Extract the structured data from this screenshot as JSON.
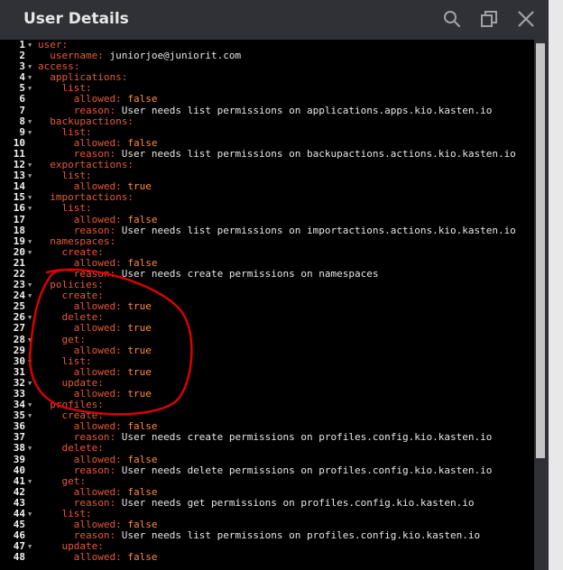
{
  "dialog": {
    "title": "User Details"
  },
  "header_icons": [
    {
      "name": "search-icon"
    },
    {
      "name": "maximize-icon"
    },
    {
      "name": "close-icon"
    }
  ],
  "colors": {
    "key": "#e8583c",
    "value": "#e8e8e8",
    "boolean": "#ff8a3d",
    "annotation": "#e00000"
  },
  "lines": [
    {
      "n": "1",
      "fold": true,
      "indent": 0,
      "key": "user",
      "value": "",
      "vtype": ""
    },
    {
      "n": "2",
      "fold": false,
      "indent": 1,
      "key": "username",
      "value": "juniorjoe@juniorit.com",
      "vtype": "str"
    },
    {
      "n": "3",
      "fold": true,
      "indent": 0,
      "key": "access",
      "value": "",
      "vtype": ""
    },
    {
      "n": "4",
      "fold": true,
      "indent": 1,
      "key": "applications",
      "value": "",
      "vtype": ""
    },
    {
      "n": "5",
      "fold": true,
      "indent": 2,
      "key": "list",
      "value": "",
      "vtype": ""
    },
    {
      "n": "6",
      "fold": false,
      "indent": 3,
      "key": "allowed",
      "value": "false",
      "vtype": "bool"
    },
    {
      "n": "7",
      "fold": false,
      "indent": 3,
      "key": "reason",
      "value": "User needs list permissions on applications.apps.kio.kasten.io",
      "vtype": "str"
    },
    {
      "n": "8",
      "fold": true,
      "indent": 1,
      "key": "backupactions",
      "value": "",
      "vtype": ""
    },
    {
      "n": "9",
      "fold": true,
      "indent": 2,
      "key": "list",
      "value": "",
      "vtype": ""
    },
    {
      "n": "10",
      "fold": false,
      "indent": 3,
      "key": "allowed",
      "value": "false",
      "vtype": "bool"
    },
    {
      "n": "11",
      "fold": false,
      "indent": 3,
      "key": "reason",
      "value": "User needs list permissions on backupactions.actions.kio.kasten.io",
      "vtype": "str"
    },
    {
      "n": "12",
      "fold": true,
      "indent": 1,
      "key": "exportactions",
      "value": "",
      "vtype": ""
    },
    {
      "n": "13",
      "fold": true,
      "indent": 2,
      "key": "list",
      "value": "",
      "vtype": ""
    },
    {
      "n": "14",
      "fold": false,
      "indent": 3,
      "key": "allowed",
      "value": "true",
      "vtype": "bool"
    },
    {
      "n": "15",
      "fold": true,
      "indent": 1,
      "key": "importactions",
      "value": "",
      "vtype": ""
    },
    {
      "n": "16",
      "fold": true,
      "indent": 2,
      "key": "list",
      "value": "",
      "vtype": ""
    },
    {
      "n": "17",
      "fold": false,
      "indent": 3,
      "key": "allowed",
      "value": "false",
      "vtype": "bool"
    },
    {
      "n": "18",
      "fold": false,
      "indent": 3,
      "key": "reason",
      "value": "User needs list permissions on importactions.actions.kio.kasten.io",
      "vtype": "str"
    },
    {
      "n": "19",
      "fold": true,
      "indent": 1,
      "key": "namespaces",
      "value": "",
      "vtype": ""
    },
    {
      "n": "20",
      "fold": true,
      "indent": 2,
      "key": "create",
      "value": "",
      "vtype": ""
    },
    {
      "n": "21",
      "fold": false,
      "indent": 3,
      "key": "allowed",
      "value": "false",
      "vtype": "bool"
    },
    {
      "n": "22",
      "fold": false,
      "indent": 3,
      "key": "reason",
      "value": "User needs create permissions on namespaces",
      "vtype": "str"
    },
    {
      "n": "23",
      "fold": true,
      "indent": 1,
      "key": "policies",
      "value": "",
      "vtype": ""
    },
    {
      "n": "24",
      "fold": true,
      "indent": 2,
      "key": "create",
      "value": "",
      "vtype": ""
    },
    {
      "n": "25",
      "fold": false,
      "indent": 3,
      "key": "allowed",
      "value": "true",
      "vtype": "bool"
    },
    {
      "n": "26",
      "fold": true,
      "indent": 2,
      "key": "delete",
      "value": "",
      "vtype": ""
    },
    {
      "n": "27",
      "fold": false,
      "indent": 3,
      "key": "allowed",
      "value": "true",
      "vtype": "bool"
    },
    {
      "n": "28",
      "fold": true,
      "indent": 2,
      "key": "get",
      "value": "",
      "vtype": ""
    },
    {
      "n": "29",
      "fold": false,
      "indent": 3,
      "key": "allowed",
      "value": "true",
      "vtype": "bool"
    },
    {
      "n": "30",
      "fold": true,
      "indent": 2,
      "key": "list",
      "value": "",
      "vtype": ""
    },
    {
      "n": "31",
      "fold": false,
      "indent": 3,
      "key": "allowed",
      "value": "true",
      "vtype": "bool"
    },
    {
      "n": "32",
      "fold": true,
      "indent": 2,
      "key": "update",
      "value": "",
      "vtype": ""
    },
    {
      "n": "33",
      "fold": false,
      "indent": 3,
      "key": "allowed",
      "value": "true",
      "vtype": "bool"
    },
    {
      "n": "34",
      "fold": true,
      "indent": 1,
      "key": "profiles",
      "value": "",
      "vtype": ""
    },
    {
      "n": "35",
      "fold": true,
      "indent": 2,
      "key": "create",
      "value": "",
      "vtype": ""
    },
    {
      "n": "36",
      "fold": false,
      "indent": 3,
      "key": "allowed",
      "value": "false",
      "vtype": "bool"
    },
    {
      "n": "37",
      "fold": false,
      "indent": 3,
      "key": "reason",
      "value": "User needs create permissions on profiles.config.kio.kasten.io",
      "vtype": "str"
    },
    {
      "n": "38",
      "fold": true,
      "indent": 2,
      "key": "delete",
      "value": "",
      "vtype": ""
    },
    {
      "n": "39",
      "fold": false,
      "indent": 3,
      "key": "allowed",
      "value": "false",
      "vtype": "bool"
    },
    {
      "n": "40",
      "fold": false,
      "indent": 3,
      "key": "reason",
      "value": "User needs delete permissions on profiles.config.kio.kasten.io",
      "vtype": "str"
    },
    {
      "n": "41",
      "fold": true,
      "indent": 2,
      "key": "get",
      "value": "",
      "vtype": ""
    },
    {
      "n": "42",
      "fold": false,
      "indent": 3,
      "key": "allowed",
      "value": "false",
      "vtype": "bool"
    },
    {
      "n": "43",
      "fold": false,
      "indent": 3,
      "key": "reason",
      "value": "User needs get permissions on profiles.config.kio.kasten.io",
      "vtype": "str"
    },
    {
      "n": "44",
      "fold": true,
      "indent": 2,
      "key": "list",
      "value": "",
      "vtype": ""
    },
    {
      "n": "45",
      "fold": false,
      "indent": 3,
      "key": "allowed",
      "value": "false",
      "vtype": "bool"
    },
    {
      "n": "46",
      "fold": false,
      "indent": 3,
      "key": "reason",
      "value": "User needs list permissions on profiles.config.kio.kasten.io",
      "vtype": "str"
    },
    {
      "n": "47",
      "fold": true,
      "indent": 2,
      "key": "update",
      "value": "",
      "vtype": ""
    },
    {
      "n": "48",
      "fold": false,
      "indent": 3,
      "key": "allowed",
      "value": "false",
      "vtype": "bool"
    }
  ]
}
